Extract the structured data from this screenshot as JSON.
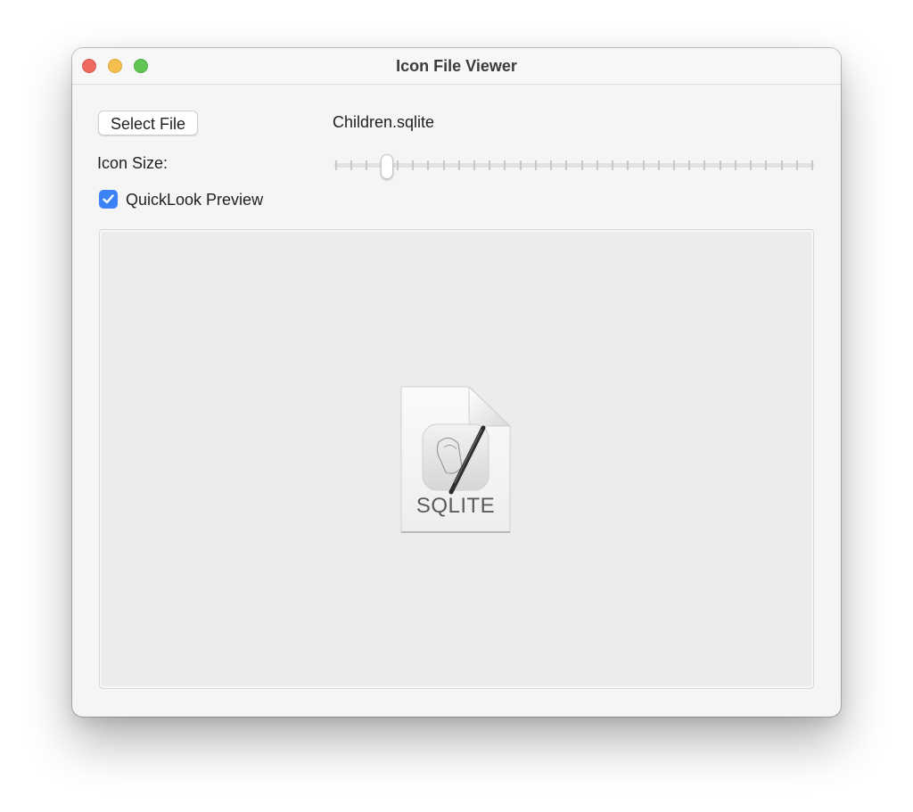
{
  "window": {
    "title": "Icon File Viewer"
  },
  "controls": {
    "select_file_label": "Select File",
    "file_name": "Children.sqlite",
    "icon_size_label": "Icon Size:",
    "icon_size_slider": {
      "tick_count": 32,
      "value_fraction": 0.1
    },
    "quicklook": {
      "label": "QuickLook Preview",
      "checked": true
    }
  },
  "preview": {
    "icon": "sqlite-document-icon",
    "extension_label": "SQLITE"
  },
  "colors": {
    "accent": "#3b82f6",
    "close": "#ee6a5f",
    "minimize": "#f5bf4f",
    "maximize": "#62c655"
  }
}
